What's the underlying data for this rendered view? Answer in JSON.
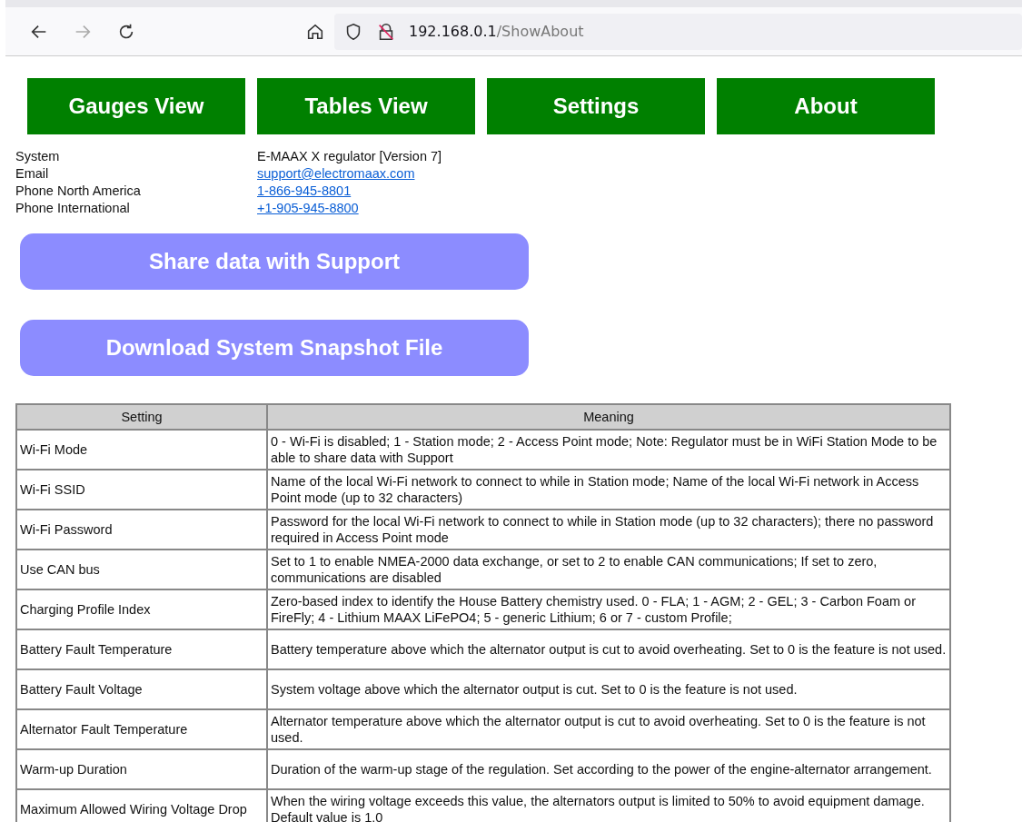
{
  "browser": {
    "address": {
      "host": "192.168.0.1",
      "path": "/ShowAbout"
    }
  },
  "nav": [
    "Gauges View",
    "Tables View",
    "Settings",
    "About"
  ],
  "info": [
    {
      "label": "System",
      "value": "E-MAAX X regulator [Version 7]",
      "kind": "text"
    },
    {
      "label": "Email",
      "value": "support@electromaax.com",
      "kind": "link"
    },
    {
      "label": "Phone North America",
      "value": "1-866-945-8801",
      "kind": "link"
    },
    {
      "label": "Phone International",
      "value": "+1-905-945-8800",
      "kind": "link"
    }
  ],
  "actions": [
    "Share data with Support",
    "Download System Snapshot File"
  ],
  "table": {
    "columns": [
      "Setting",
      "Meaning"
    ],
    "rows": [
      {
        "setting": "Wi-Fi Mode",
        "meaning": "0 - Wi-Fi is disabled; 1 - Station mode; 2 - Access Point mode; Note: Regulator must be in WiFi Station Mode to be able to share data with Support"
      },
      {
        "setting": "Wi-Fi SSID",
        "meaning": "Name of the local Wi-Fi network to connect to while in Station mode; Name of the local Wi-Fi network in Access Point mode (up to 32 characters)"
      },
      {
        "setting": "Wi-Fi Password",
        "meaning": "Password for the local Wi-Fi network to connect to while in Station mode (up to 32 characters); there no password required in Access Point mode"
      },
      {
        "setting": "Use CAN bus",
        "meaning": "Set to 1 to enable NMEA-2000 data exchange, or set to 2 to enable CAN communications; If set to zero, communications are disabled"
      },
      {
        "setting": "Charging Profile Index",
        "meaning": "Zero-based index to identify the House Battery chemistry used. 0 - FLA; 1 - AGM; 2 - GEL; 3 - Carbon Foam or FireFly; 4 - Lithium MAAX LiFePO4; 5 - generic Lithium; 6 or 7 - custom Profile;"
      },
      {
        "setting": "Battery Fault Temperature",
        "meaning": "Battery temperature above which the alternator output is cut to avoid overheating. Set to 0 is the feature is not used."
      },
      {
        "setting": "Battery Fault Voltage",
        "meaning": "System voltage above which the alternator output is cut. Set to 0 is the feature is not used."
      },
      {
        "setting": "Alternator Fault Temperature",
        "meaning": "Alternator temperature above which the alternator output is cut to avoid overheating. Set to 0 is the feature is not used."
      },
      {
        "setting": "Warm-up Duration",
        "meaning": "Duration of the warm-up stage of the regulation. Set according to the power of the engine-alternator arrangement."
      },
      {
        "setting": "Maximum Allowed Wiring Voltage Drop",
        "meaning": "When the wiring voltage exceeds this value, the alternators output is limited to 50% to avoid equipment damage. Default value is 1.0"
      }
    ]
  }
}
